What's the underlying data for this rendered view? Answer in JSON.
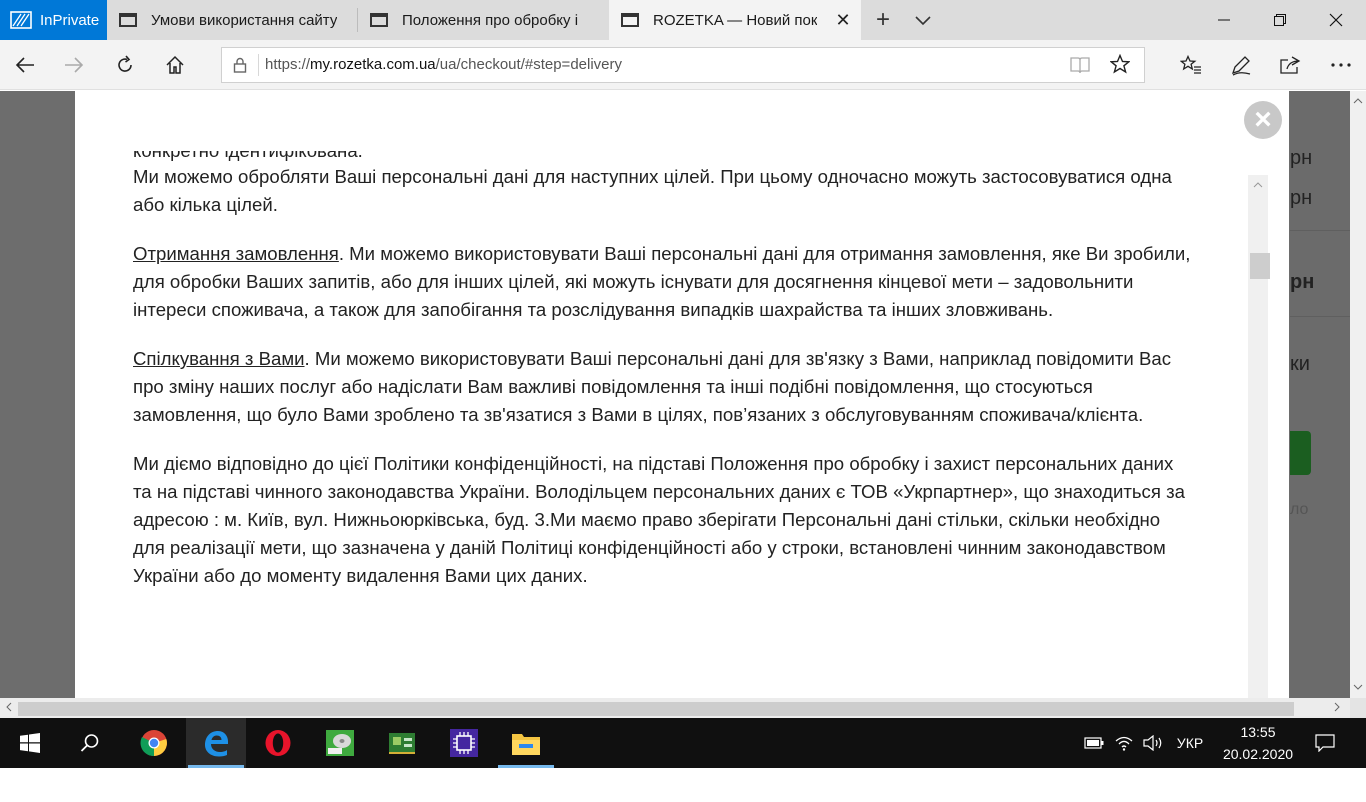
{
  "browser": {
    "inprivate_label": "InPrivate",
    "tabs": [
      {
        "title": "Умови використання сайту"
      },
      {
        "title": "Положення про обробку і"
      },
      {
        "title": "ROZETKA — Новий пок",
        "close": "✕"
      }
    ],
    "new_tab": "+",
    "url_prefix": "https://",
    "url_host": "my.rozetka.com.ua",
    "url_path": "/ua/checkout/#step=delivery",
    "window": {
      "minimize": "—",
      "maximize": "❐",
      "close": "✕"
    }
  },
  "modal": {
    "close": "×",
    "clipped_top_line": "конкретно ідентифікована.",
    "intro": "Ми можемо обробляти Ваші персональні дані для наступних цілей. При цьому одночасно можуть застосовуватися одна або кілька цілей.",
    "section1_title": "Отримання замовлення",
    "section1_text": ". Ми можемо використовувати Ваші персональні дані для отримання замовлення, яке Ви зробили, для обробки Ваших запитів, або для інших цілей, які можуть існувати для досягнення кінцевої мети – задовольнити інтереси споживача, а також для запобігання та розслідування випадків шахрайства та інших зловживань.",
    "section2_title": "Спілкування з Вами",
    "section2_text": ". Ми можемо використовувати Ваші персональні дані для зв'язку з Вами, наприклад повідомити Вас про зміну наших послуг або надіслати Вам важливі повідомлення та інші подібні повідомлення, що стосуються замовлення, що було Вами зроблено та зв'язатися з Вами в цілях, пов’язаних з обслуговуванням споживача/клієнта.",
    "paragraph3": "Ми діємо відповідно до цієї Політики конфіденційності, на підставі Положення про обробку і захист персональних даних та на підставі чинного законодавства України. Володільцем персональних даних є ТОВ «Укрпартнер», що знаходиться за адресою : м. Київ, вул. Нижньоюрківська, буд. 3.Ми маємо право зберігати Персональні дані стільки, скільки необхідно для реалізації мети, що зазначена у даній Політиці конфіденційності або у строки, встановлені чинним законодавством України або до моменту видалення Вами цих даних."
  },
  "background_site": {
    "fragments": [
      "рн",
      "рн",
      "рн",
      "ки",
      "ло"
    ]
  },
  "taskbar": {
    "language": "УКР",
    "time": "13:55",
    "date": "20.02.2020"
  }
}
